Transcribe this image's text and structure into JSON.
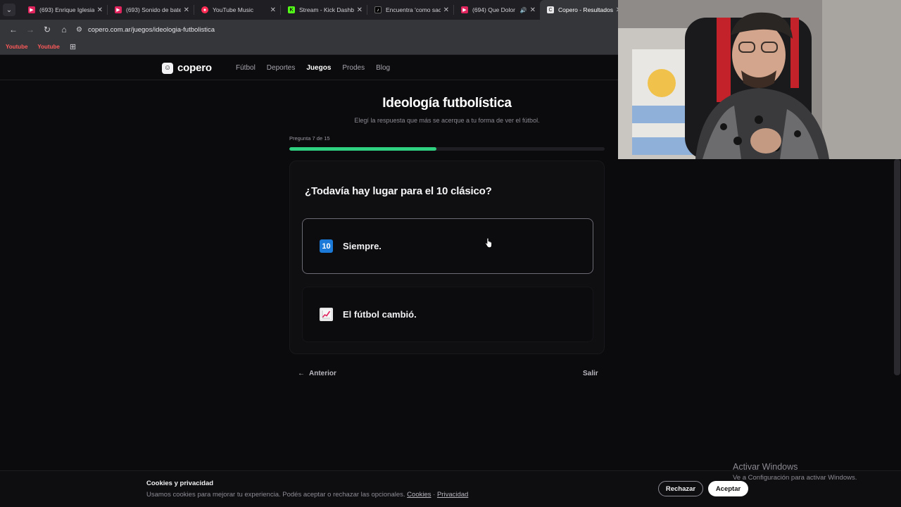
{
  "browser": {
    "tabs": [
      {
        "title": "(693) Enrique Iglesias",
        "favicon": "youtube-icon"
      },
      {
        "title": "(693) Sonido de bater",
        "favicon": "youtube-icon"
      },
      {
        "title": "YouTube Music",
        "favicon": "youtube-music-icon"
      },
      {
        "title": "Stream - Kick Dashbo",
        "favicon": "kick-icon"
      },
      {
        "title": "Encuentra 'como sac",
        "favicon": "tiktok-icon"
      },
      {
        "title": "(694) Que Dolor",
        "favicon": "youtube-icon"
      },
      {
        "title": "Copero - Resultados",
        "favicon": "copero-icon"
      }
    ],
    "address": "copero.com.ar/juegos/ideologia-futbolistica",
    "bookmarks": [
      "Youtube",
      "Youtube"
    ]
  },
  "site": {
    "brand": "copero",
    "nav": [
      "Fútbol",
      "Deportes",
      "Juegos",
      "Prodes",
      "Blog"
    ],
    "active_nav": "Juegos"
  },
  "quiz": {
    "title": "Ideología futbolística",
    "subtitle": "Elegí la respuesta que más se acerque a tu forma de ver el fútbol.",
    "progress_label": "Pregunta 7 de 15",
    "progress": 0.466,
    "question": "¿Todavía hay lugar para el 10 clásico?",
    "options": [
      {
        "emoji": "🔟",
        "emoji_text": "10",
        "label": "Siempre."
      },
      {
        "emoji": "📈",
        "label": "El fútbol cambió."
      }
    ],
    "prev_label": "Anterior",
    "exit_label": "Salir"
  },
  "cookies": {
    "title": "Cookies y privacidad",
    "text": "Usamos cookies para mejorar tu experiencia. Podés aceptar o rechazar las opcionales.",
    "link_cookies": "Cookies",
    "separator": "·",
    "link_privacy": "Privacidad",
    "reject_label": "Rechazar",
    "accept_label": "Aceptar"
  },
  "watermark": {
    "title": "Activar Windows",
    "subtitle": "Ve a Configuración para activar Windows."
  },
  "colors": {
    "accent_progress": "#2fd07f",
    "background": "#0b0b0d"
  }
}
